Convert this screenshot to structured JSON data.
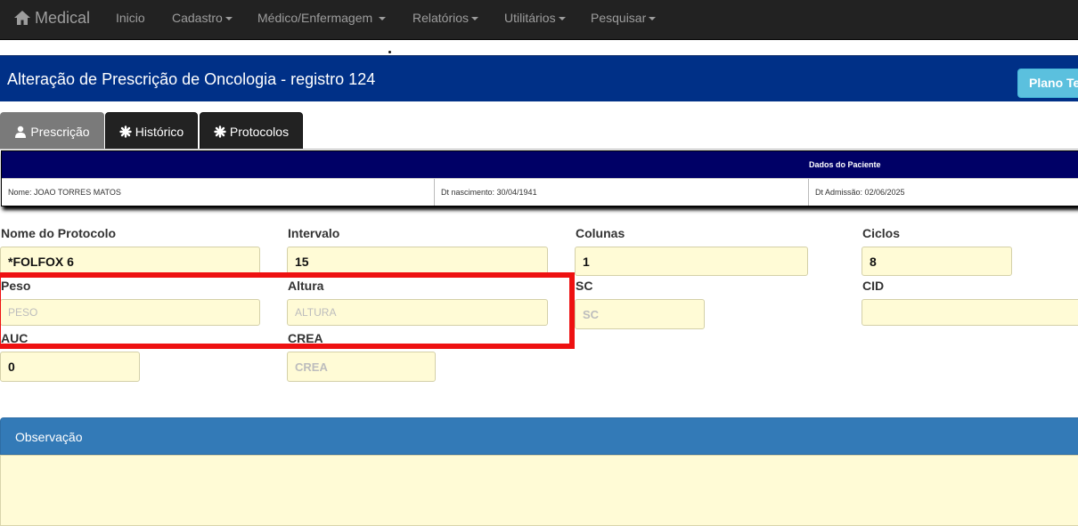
{
  "navbar": {
    "brand": "Medical",
    "items": [
      {
        "label": "Inicio",
        "dropdown": false
      },
      {
        "label": "Cadastro",
        "dropdown": true
      },
      {
        "label": "Médico/Enfermagem",
        "dropdown": true
      },
      {
        "label": "Relatórios",
        "dropdown": true
      },
      {
        "label": "Utilitários",
        "dropdown": true
      },
      {
        "label": "Pesquisar",
        "dropdown": true
      }
    ]
  },
  "header": {
    "title": "Alteração de Prescrição de Oncologia - registro 124",
    "plano_button": "Plano Te"
  },
  "tabs": [
    {
      "label": "Prescrição",
      "icon": "user-icon",
      "active": true
    },
    {
      "label": "Histórico",
      "icon": "asterisk-icon",
      "active": false
    },
    {
      "label": "Protocolos",
      "icon": "asterisk-icon",
      "active": false
    }
  ],
  "patient": {
    "section_title": "Dados do Paciente",
    "nome": "Nome: JOAO TORRES MATOS",
    "nascimento": "Dt nascimento: 30/04/1941",
    "admissao": "Dt Admissão: 02/06/2025"
  },
  "form": {
    "protocolo": {
      "label": "Nome do Protocolo",
      "value": "*FOLFOX 6"
    },
    "intervalo": {
      "label": "Intervalo",
      "value": "15"
    },
    "colunas": {
      "label": "Colunas",
      "value": "1"
    },
    "ciclos": {
      "label": "Ciclos",
      "value": "8"
    },
    "peso": {
      "label": "Peso",
      "placeholder": "PESO"
    },
    "altura": {
      "label": "Altura",
      "placeholder": "ALTURA"
    },
    "sc": {
      "label": "SC",
      "placeholder": "SC"
    },
    "cid": {
      "label": "CID",
      "value": ""
    },
    "auc": {
      "label": "AUC",
      "value": "0"
    },
    "crea": {
      "label": "CREA",
      "placeholder": "CREA"
    }
  },
  "observacao": {
    "title": "Observação",
    "value": ""
  },
  "colors": {
    "navbar": "#222222",
    "title_bar": "#003087",
    "patient_header": "#000066",
    "field_bg": "#fffbd6",
    "panel_head": "#337ab7",
    "highlight": "#ee1111",
    "info_button": "#5bc0de"
  }
}
